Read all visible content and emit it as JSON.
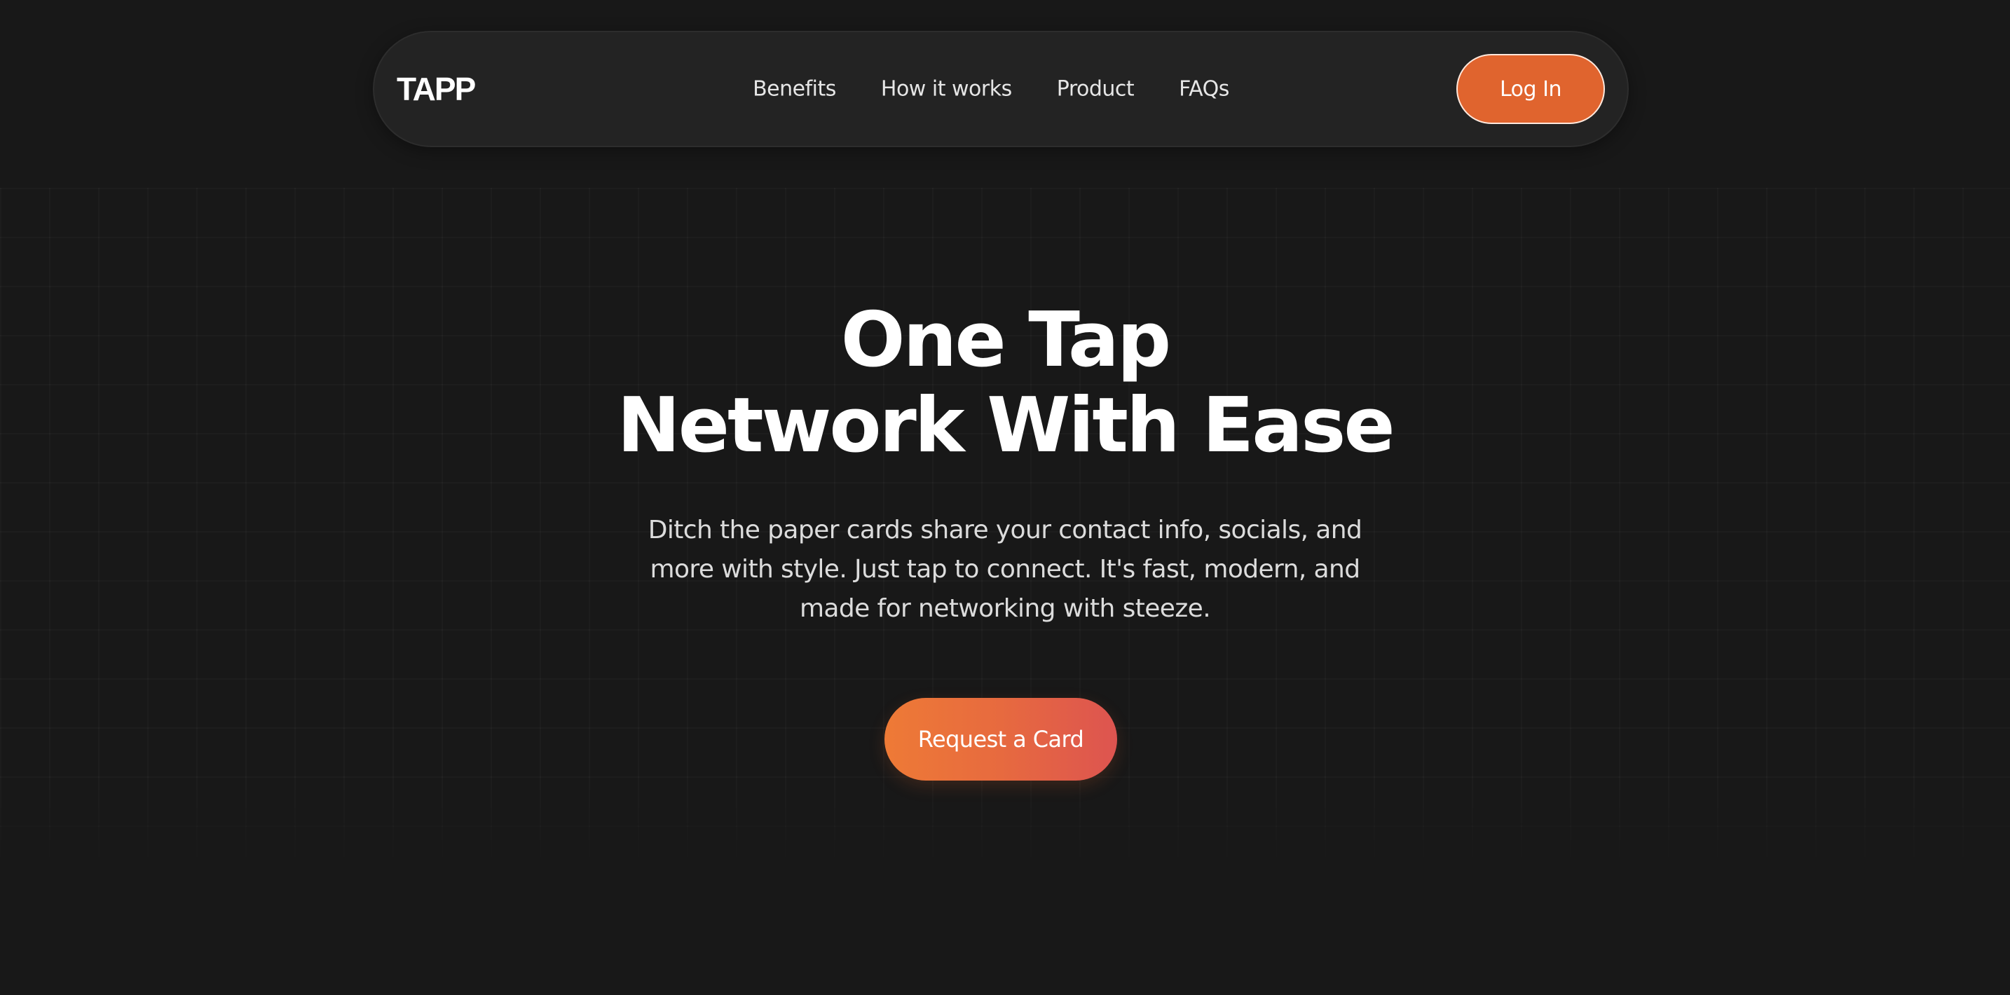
{
  "header": {
    "logo": "TAPP",
    "nav": [
      {
        "label": "Benefits"
      },
      {
        "label": "How it works"
      },
      {
        "label": "Product"
      },
      {
        "label": "FAQs"
      }
    ],
    "login_label": "Log In"
  },
  "hero": {
    "title_line1": "One Tap",
    "title_line2": "Network With Ease",
    "description": "Ditch the paper cards share your contact info, socials, and more with style. Just tap to connect. It's fast, modern, and made for networking with steeze.",
    "cta_label": "Request a Card"
  },
  "colors": {
    "background": "#181818",
    "navbar": "#232323",
    "accent": "#e0642e",
    "cta_gradient_start": "#ee7a36",
    "cta_gradient_end": "#dd5450"
  }
}
